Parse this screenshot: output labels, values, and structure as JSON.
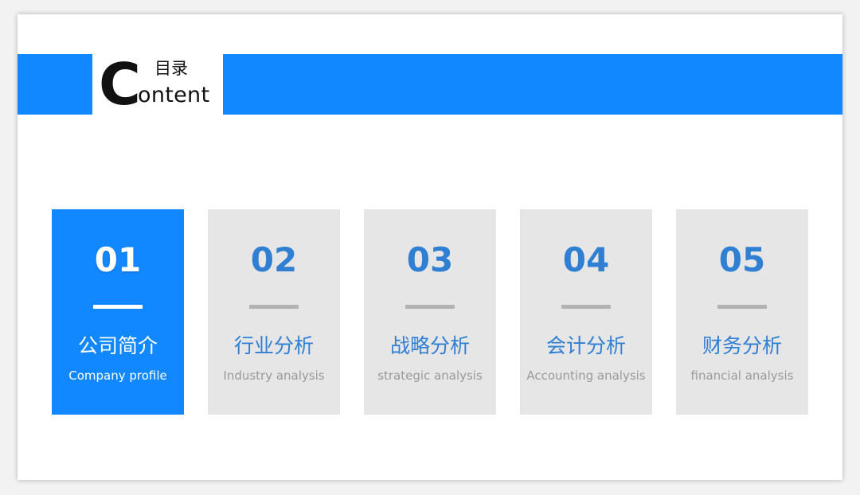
{
  "title": {
    "big_letter": "C",
    "cn": "目录",
    "en": "ontent"
  },
  "colors": {
    "accent": "#1188ff",
    "number_blue": "#2f7fd3",
    "card_gray": "#e6e6e6",
    "divider_gray": "#b3b3b3",
    "subtitle_gray": "#9a9a9a"
  },
  "items": [
    {
      "num": "01",
      "cn": "公司简介",
      "en": "Company profile",
      "active": true
    },
    {
      "num": "02",
      "cn": "行业分析",
      "en": "Industry analysis",
      "active": false
    },
    {
      "num": "03",
      "cn": "战略分析",
      "en": "strategic analysis",
      "active": false
    },
    {
      "num": "04",
      "cn": "会计分析",
      "en": "Accounting analysis",
      "active": false
    },
    {
      "num": "05",
      "cn": "财务分析",
      "en": "financial analysis",
      "active": false
    }
  ]
}
